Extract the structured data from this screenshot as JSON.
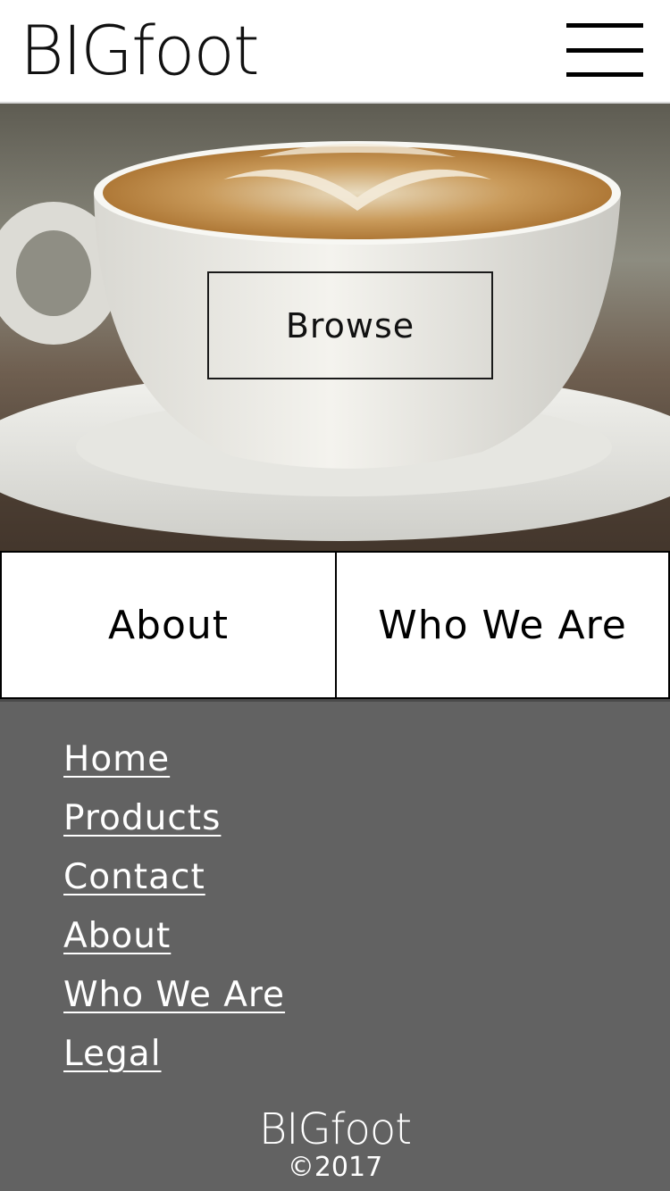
{
  "header": {
    "logo_text": "BIGfoot",
    "menu_icon": "hamburger-menu-icon"
  },
  "hero": {
    "image_subject": "latte-cup-photo",
    "browse_label": "Browse"
  },
  "tiles": {
    "about_label": "About",
    "who_we_are_label": "Who We Are"
  },
  "footer": {
    "links": [
      {
        "label": "Home"
      },
      {
        "label": "Products"
      },
      {
        "label": "Contact"
      },
      {
        "label": "About"
      },
      {
        "label": "Who We Are"
      },
      {
        "label": "Legal"
      }
    ],
    "logo_text": "BIGfoot",
    "copyright": "©2017"
  },
  "colors": {
    "footer_background": "#626262",
    "header_background": "#ffffff",
    "text_dark": "#000000",
    "text_light": "#ffffff"
  }
}
